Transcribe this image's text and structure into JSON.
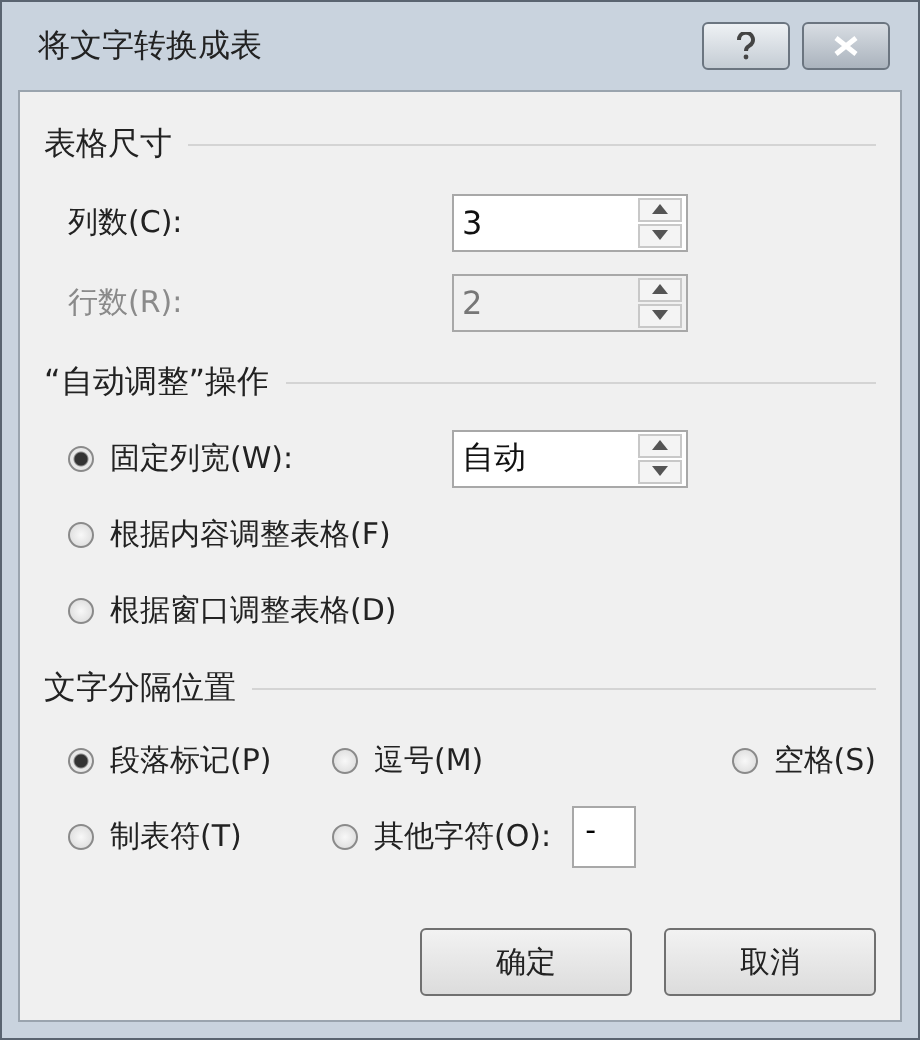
{
  "window": {
    "title": "将文字转换成表"
  },
  "table_size": {
    "title": "表格尺寸",
    "fields": [
      {
        "label": "列数(C):",
        "value": "3",
        "disabled": false
      },
      {
        "label": "行数(R):",
        "value": "2",
        "disabled": true
      }
    ]
  },
  "autofit": {
    "title": "“自动调整”操作",
    "options": [
      {
        "label": "固定列宽(W):",
        "selected": true,
        "spinner_value": "自动"
      },
      {
        "label": "根据内容调整表格(F)",
        "selected": false
      },
      {
        "label": "根据窗口调整表格(D)",
        "selected": false
      }
    ]
  },
  "separator": {
    "title": "文字分隔位置",
    "options": [
      {
        "label": "段落标记(P)",
        "selected": true
      },
      {
        "label": "逗号(M)",
        "selected": false
      },
      {
        "label": "空格(S)",
        "selected": false
      },
      {
        "label": "制表符(T)",
        "selected": false
      },
      {
        "label": "其他字符(O):",
        "selected": false,
        "field_value": "-"
      }
    ]
  },
  "buttons": [
    {
      "label": "确定"
    },
    {
      "label": "取消"
    }
  ]
}
